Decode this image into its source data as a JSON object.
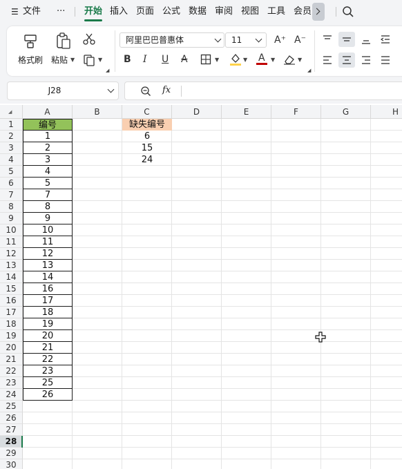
{
  "menubar": {
    "hamburger_glyph": "☰",
    "file_label": "文件",
    "more_glyph": "···",
    "tabs": [
      "开始",
      "插入",
      "页面",
      "公式",
      "数据",
      "审阅",
      "视图",
      "工具",
      "会员"
    ],
    "active_tab": "开始"
  },
  "ribbon": {
    "format_painter_label": "格式刷",
    "paste_label": "粘贴",
    "font_name": "阿里巴巴普惠体",
    "font_size": "11",
    "grow_font": "A⁺",
    "shrink_font": "A⁻",
    "bold": "B",
    "italic": "I",
    "underline": "U",
    "strike": "A",
    "font_color_glyph": "A",
    "font_color": "#c00000",
    "fill_color": "#ffd24a"
  },
  "name_box": {
    "value": "J28"
  },
  "formula_bar": {
    "fx": "fx",
    "value": ""
  },
  "grid": {
    "columns": [
      "A",
      "B",
      "C",
      "D",
      "E",
      "F",
      "G",
      "H"
    ],
    "rows": [
      "1",
      "2",
      "3",
      "4",
      "5",
      "6",
      "7",
      "8",
      "9",
      "10",
      "11",
      "12",
      "13",
      "14",
      "15",
      "16",
      "17",
      "18",
      "19",
      "20",
      "21",
      "22",
      "23",
      "24",
      "25",
      "26",
      "27",
      "28",
      "29",
      "30"
    ],
    "selected_row": "28",
    "col_a": [
      "编号",
      "1",
      "2",
      "3",
      "4",
      "5",
      "7",
      "8",
      "9",
      "10",
      "11",
      "12",
      "13",
      "14",
      "16",
      "17",
      "18",
      "19",
      "20",
      "21",
      "22",
      "23",
      "25",
      "26"
    ],
    "col_c": [
      "缺失编号",
      "6",
      "15",
      "24"
    ]
  },
  "colors": {
    "accent": "#1a7a4a",
    "header_a_fill": "#93c25a",
    "header_c_fill": "#f9cfb1"
  }
}
